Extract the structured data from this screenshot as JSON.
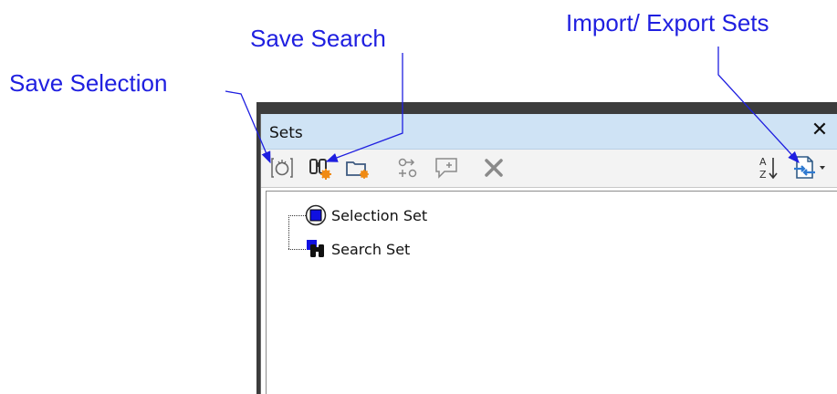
{
  "callouts": {
    "save_selection": "Save Selection",
    "save_search": "Save Search",
    "import_export": "Import/ Export Sets"
  },
  "panel": {
    "title": "Sets",
    "close_glyph": "✕"
  },
  "toolbar": {
    "buttons": [
      {
        "name": "save-selection-button",
        "icon": "save-selection-icon"
      },
      {
        "name": "save-search-button",
        "icon": "binoculars-icon"
      },
      {
        "name": "add-folder-button",
        "icon": "new-folder-icon"
      },
      {
        "name": "duplicate-button",
        "icon": "duplicate-icon"
      },
      {
        "name": "add-comment-button",
        "icon": "add-comment-icon"
      },
      {
        "name": "delete-button",
        "icon": "delete-icon"
      },
      {
        "name": "sort-button",
        "icon": "sort-az-icon"
      },
      {
        "name": "import-export-button",
        "icon": "import-export-icon"
      }
    ]
  },
  "tree": {
    "items": [
      {
        "label": "Selection Set",
        "icon": "selection-set-icon"
      },
      {
        "label": "Search Set",
        "icon": "search-set-icon"
      }
    ]
  },
  "colors": {
    "callout_text": "#1f1fe0",
    "titlebar": "#cfe3f5",
    "toolbar": "#f3f3f3",
    "accent_orange": "#f08a12"
  }
}
